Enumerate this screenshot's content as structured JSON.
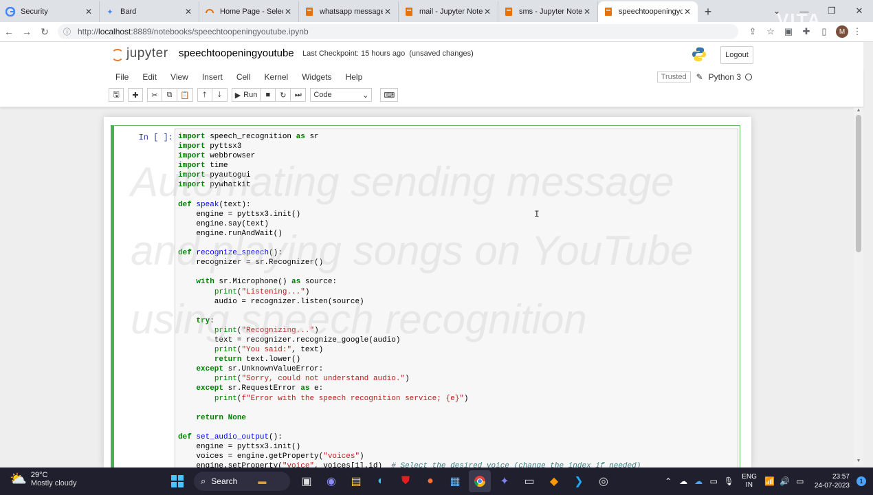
{
  "browser": {
    "tabs": [
      {
        "title": "Security",
        "icon": "google-icon",
        "active": false
      },
      {
        "title": "Bard",
        "icon": "bard-icon",
        "active": false
      },
      {
        "title": "Home Page - Select o",
        "icon": "loading-icon",
        "active": false
      },
      {
        "title": "whatsapp message - ",
        "icon": "jupyter-icon",
        "active": false
      },
      {
        "title": "mail - Jupyter Noteb",
        "icon": "jupyter-icon",
        "active": false
      },
      {
        "title": "sms - Jupyter Notebo",
        "icon": "jupyter-icon",
        "active": false
      },
      {
        "title": "speechtoopeningyoutu",
        "icon": "jupyter-icon",
        "active": true
      }
    ],
    "url_host": "localhost",
    "url_prefix": "http://",
    "url_path": ":8889/notebooks/speechtoopeningyoutube.ipynb",
    "profile_initial": "M"
  },
  "jupyter": {
    "logo_text": "jupyter",
    "notebook_name": "speechtoopeningyoutube",
    "checkpoint": "Last Checkpoint: 15 hours ago",
    "unsaved": "(unsaved changes)",
    "logout_label": "Logout",
    "menu": [
      "File",
      "Edit",
      "View",
      "Insert",
      "Cell",
      "Kernel",
      "Widgets",
      "Help"
    ],
    "trusted_label": "Trusted",
    "kernel_name": "Python 3",
    "run_label": "Run",
    "cell_type": "Code",
    "prompt": "In [ ]:"
  },
  "watermark": {
    "lines": [
      "Automating sending message",
      "and playing songs on YouTube",
      "using speech recognition"
    ]
  },
  "taskbar": {
    "temperature": "29°C",
    "weather": "Mostly cloudy",
    "search_label": "Search",
    "lang_line1": "ENG",
    "lang_line2": "IN",
    "time": "23:57",
    "date": "24-07-2023",
    "notification_count": "1"
  },
  "overlay_logo": "VITA"
}
